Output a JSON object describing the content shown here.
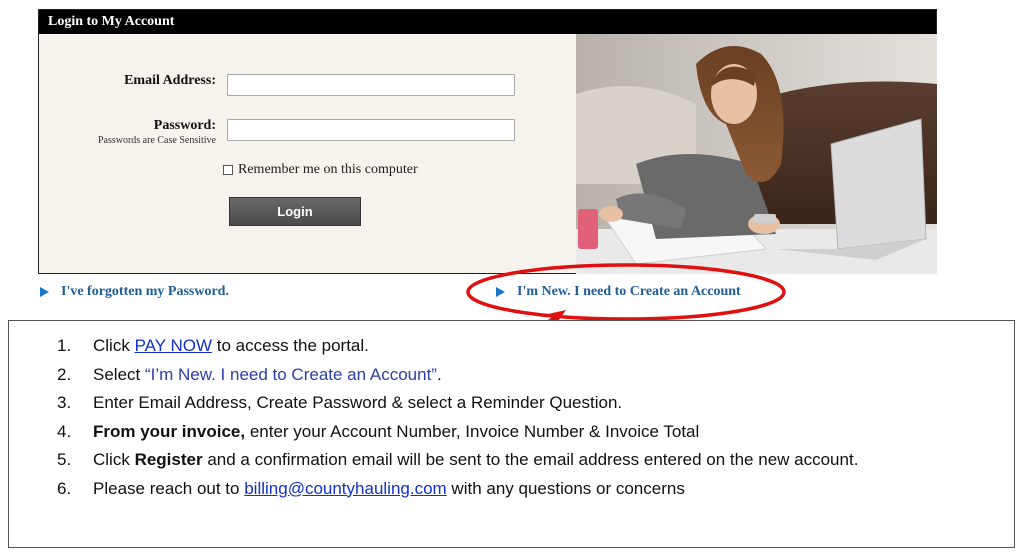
{
  "login_panel": {
    "header": "Login to My Account",
    "email_label": "Email Address:",
    "email_value": "",
    "password_label": "Password:",
    "password_note": "Passwords are Case Sensitive",
    "password_value": "",
    "remember_label": "Remember me on this computer",
    "login_button": "Login"
  },
  "links": {
    "forgot_password": "I've forgotten my Password.",
    "new_account": "I'm New. I need to Create an Account"
  },
  "instructions": {
    "items": [
      {
        "num": "1.",
        "pre": "Click ",
        "link": "PAY NOW",
        "post": " to access the portal."
      },
      {
        "num": "2.",
        "pre": "Select ",
        "quote": "“I’m New. I need to Create an Account”",
        "post": "."
      },
      {
        "num": "3.",
        "text": "Enter Email Address, Create Password & select a Reminder Question."
      },
      {
        "num": "4.",
        "bold": "From your invoice,",
        "post": " enter your Account Number, Invoice Number & Invoice Total"
      },
      {
        "num": "5.",
        "pre": "Click ",
        "bold": "Register",
        "post": " and a confirmation email will be sent to the email address entered on the new account."
      },
      {
        "num": "6.",
        "pre": "Please reach out to ",
        "link": "billing@countyhauling.com",
        "post": " with any questions or concerns"
      }
    ]
  },
  "colors": {
    "annotation_red": "#e01010",
    "link_blue": "#1f5c99",
    "panel_bg": "#f6f2ec"
  }
}
